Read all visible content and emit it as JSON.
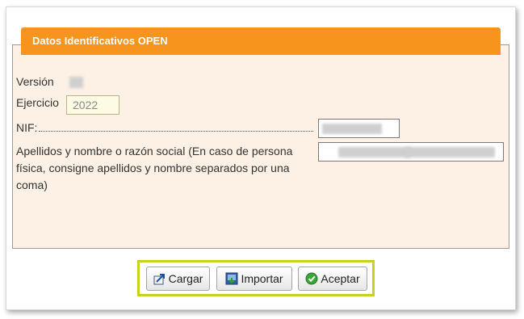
{
  "section": {
    "title": "Datos Identificativos OPEN"
  },
  "fields": {
    "version_label": "Versión",
    "ejercicio_label": "Ejercicio",
    "ejercicio_value": "2022",
    "nif_label": "NIF:",
    "apellidos_label_lines": [
      "Apellidos y nombre o razón social (En caso de persona",
      "física, consigne apellidos y nombre separados por una",
      "coma)"
    ]
  },
  "buttons": {
    "cargar": "Cargar",
    "importar": "Importar",
    "aceptar": "Aceptar"
  },
  "colors": {
    "header": "#f7941d",
    "panel_bg": "#fdf0e4",
    "highlight": "#c9cf23"
  },
  "icons": [
    "load-icon",
    "import-icon",
    "accept-check-icon"
  ]
}
